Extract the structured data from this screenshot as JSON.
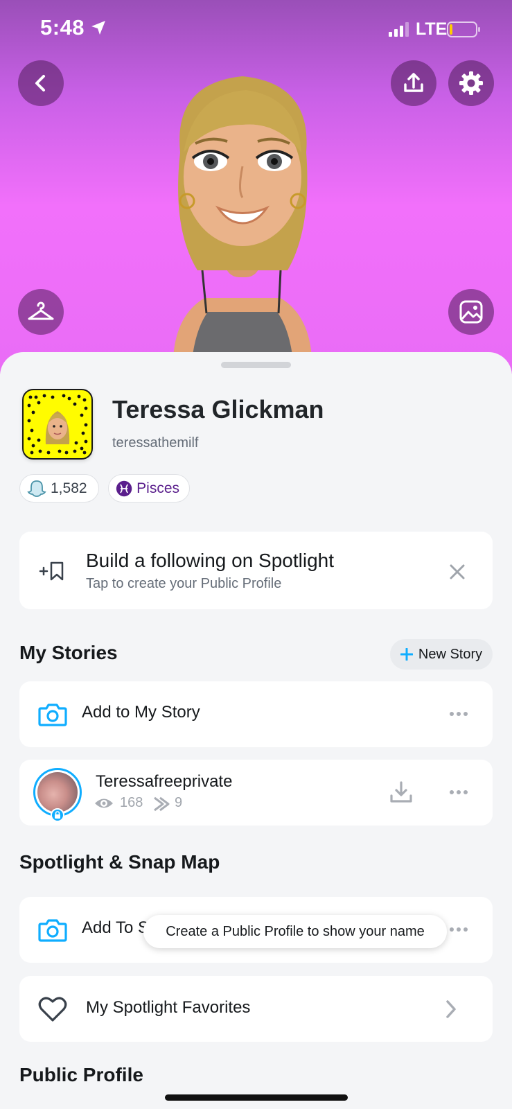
{
  "status_bar": {
    "time": "5:48",
    "network": "LTE"
  },
  "header": {
    "back_icon": "chevron-left-icon",
    "share_icon": "upload-icon",
    "settings_icon": "gear-icon",
    "outfit_icon": "hanger-icon",
    "background_icon": "picture-icon"
  },
  "profile": {
    "display_name": "Teressa Glickman",
    "username": "teressathemilf",
    "snap_score": "1,582",
    "zodiac": "Pisces"
  },
  "spotlight_promo": {
    "title": "Build a following on Spotlight",
    "subtitle": "Tap to create your Public Profile"
  },
  "my_stories": {
    "section_title": "My Stories",
    "new_story_label": "New Story",
    "add_label": "Add to My Story",
    "private_story": {
      "name": "Teressafreeprivate",
      "views": "168",
      "screenshots": "9"
    }
  },
  "spotlight_map": {
    "section_title": "Spotlight & Snap Map",
    "add_label_visible": "Add To S",
    "tooltip": "Create a Public Profile to show your name",
    "favorites_label": "My Spotlight Favorites"
  },
  "public_profile": {
    "section_title": "Public Profile"
  },
  "colors": {
    "accent_blue": "#0fadff",
    "snap_yellow": "#fffc00",
    "zodiac_purple": "#5a1e8c"
  }
}
